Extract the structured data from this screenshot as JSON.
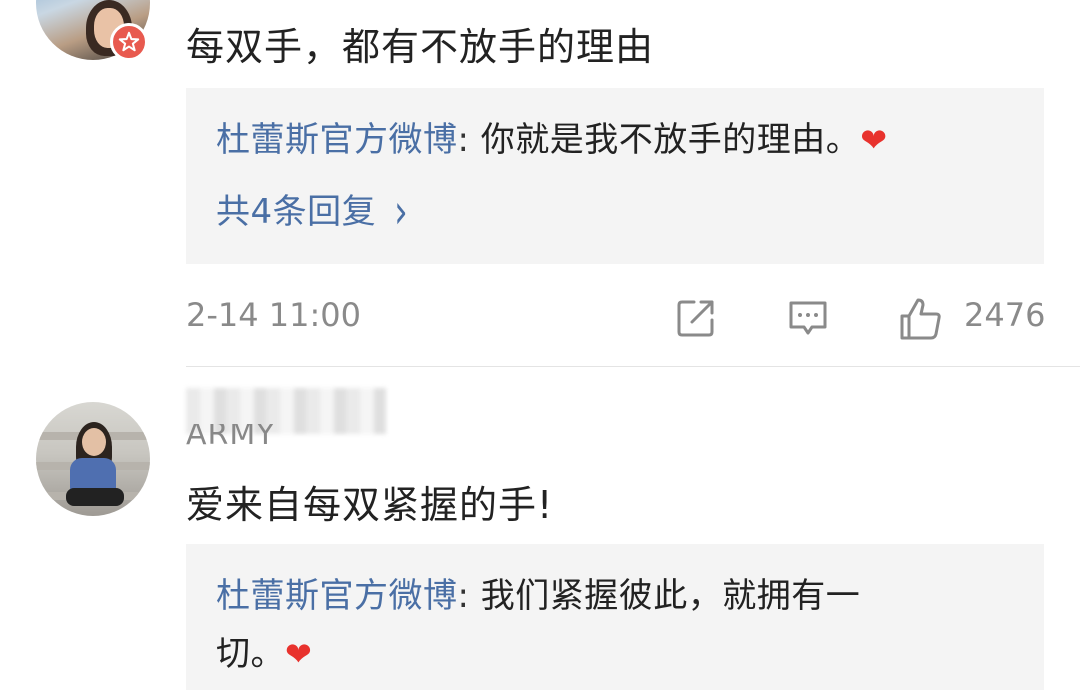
{
  "comments": [
    {
      "text": "每双手，都有不放手的理由",
      "reply": {
        "author": "杜蕾斯官方微博",
        "separator": ": ",
        "content_line1": "你就是我不放手的理由。",
        "heart": "❤"
      },
      "more_replies": "共4条回复",
      "more_chevron": "›",
      "timestamp": "2-14 11:00",
      "like_count": "2476",
      "icons": [
        "share-icon",
        "comment-icon",
        "like-icon",
        "verified-badge-icon"
      ]
    },
    {
      "username": "ARMY",
      "text": "爱来自每双紧握的手!",
      "reply": {
        "author": "杜蕾斯官方微博",
        "separator": ": ",
        "content_line1": "我们紧握彼此，就拥有一",
        "content_line2": "切。",
        "heart": "❤"
      }
    }
  ],
  "colors": {
    "link_blue": "#4a6fa5",
    "reply_bg": "#f4f4f4",
    "meta_gray": "#8a8a8a",
    "badge_red": "#e85a4f",
    "heart_red": "#e8322d"
  }
}
